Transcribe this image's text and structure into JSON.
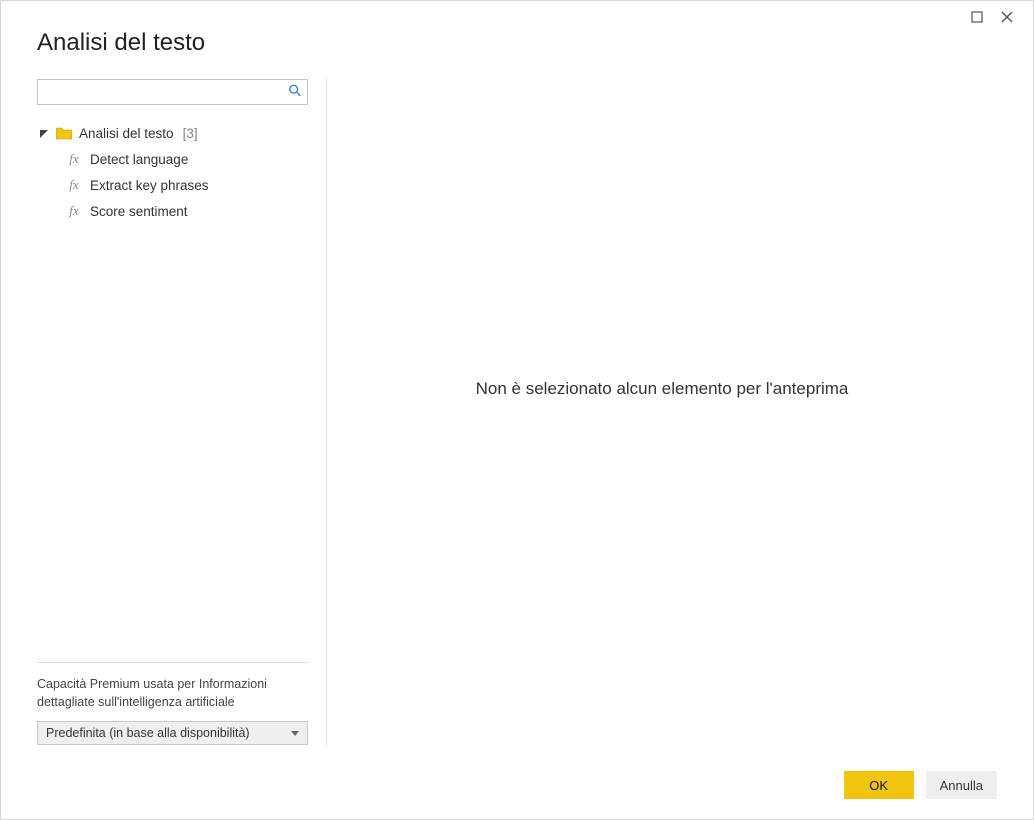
{
  "window": {
    "title": "Analisi del testo",
    "maximize_title": "Maximize",
    "close_title": "Close"
  },
  "search": {
    "value": "",
    "placeholder": ""
  },
  "tree": {
    "root": {
      "label": "Analisi del testo",
      "count": "[3]"
    },
    "items": [
      {
        "label": "Detect language"
      },
      {
        "label": "Extract key phrases"
      },
      {
        "label": "Score sentiment"
      }
    ]
  },
  "capacity": {
    "label": "Capacità Premium usata per Informazioni dettagliate sull'intelligenza artificiale",
    "selected": "Predefinita (in base alla disponibilità)"
  },
  "preview": {
    "empty_message": "Non è selezionato alcun elemento per l'anteprima"
  },
  "buttons": {
    "ok": "OK",
    "cancel": "Annulla"
  }
}
